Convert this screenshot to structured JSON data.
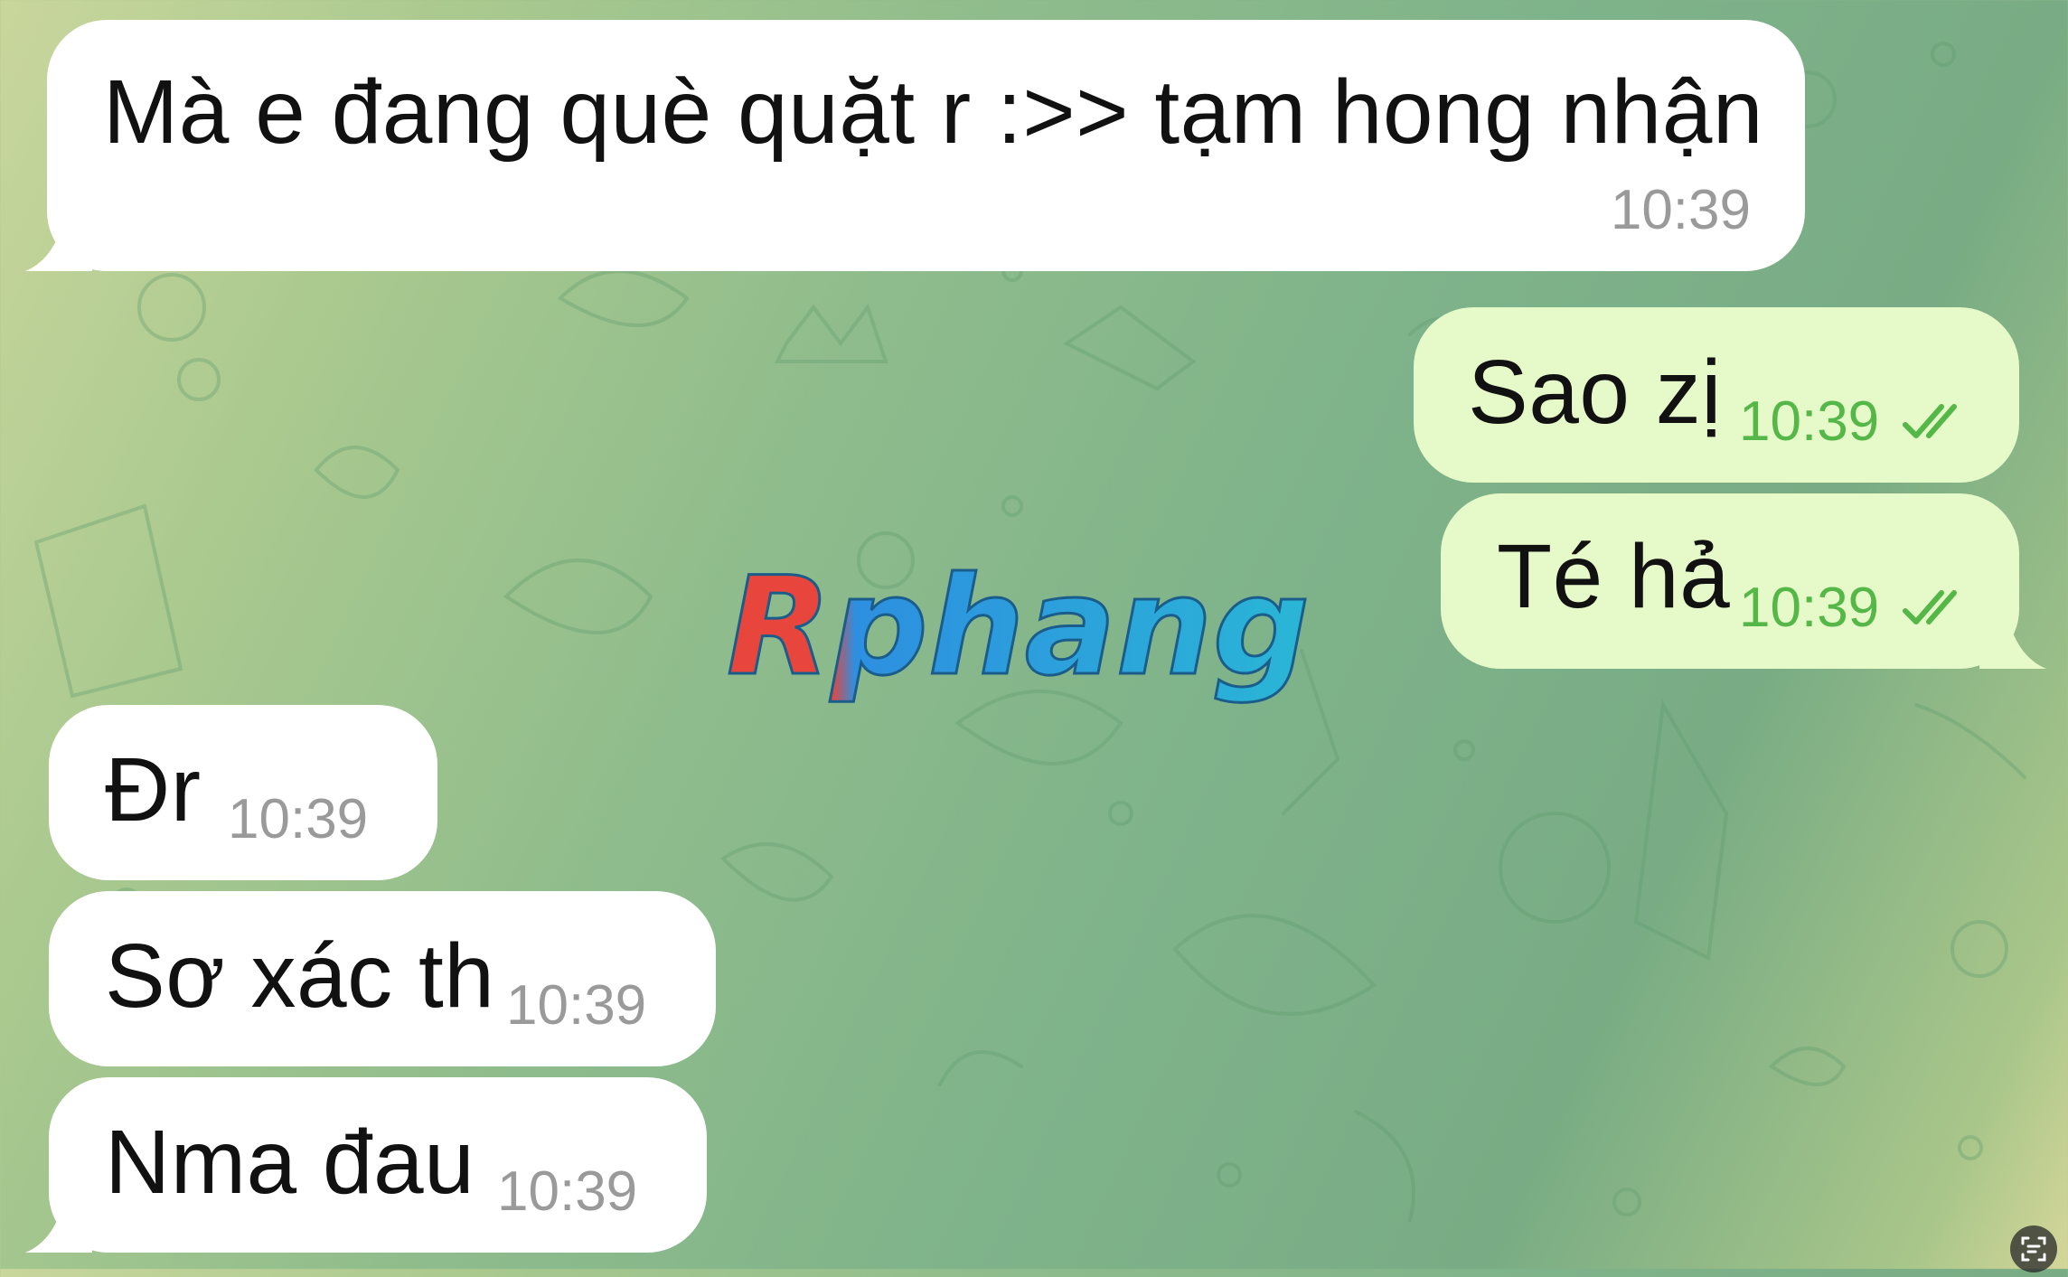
{
  "messages": [
    {
      "direction": "incoming",
      "text": "Mà e đang què quặt r :>> tạm hong nhận",
      "time": "10:39"
    },
    {
      "direction": "outgoing",
      "text": "Sao zị",
      "time": "10:39",
      "status": "read"
    },
    {
      "direction": "outgoing",
      "text": "Té hả",
      "time": "10:39",
      "status": "read"
    },
    {
      "direction": "incoming",
      "text": "Đr",
      "time": "10:39"
    },
    {
      "direction": "incoming",
      "text": "Sơ xác th",
      "time": "10:39"
    },
    {
      "direction": "incoming",
      "text": "Nma đau",
      "time": "10:39"
    }
  ],
  "watermark": {
    "text": "Rphang"
  },
  "icons": {
    "read_status": "double-check-icon",
    "scan": "scan-text-icon"
  },
  "colors": {
    "incoming_bubble": "#ffffff",
    "outgoing_bubble": "#e6f9c9",
    "outgoing_time": "#55b748",
    "incoming_time": "#9a9a9a",
    "wallpaper_accent": "#7fb38a"
  }
}
